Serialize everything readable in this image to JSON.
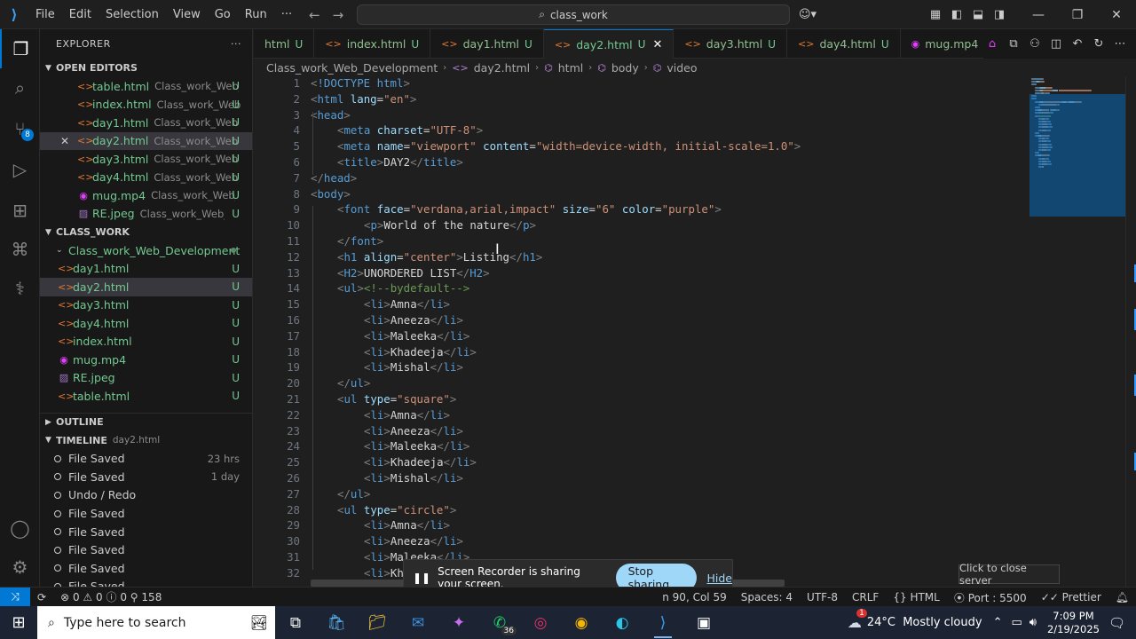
{
  "menu": [
    "File",
    "Edit",
    "Selection",
    "View",
    "Go",
    "Run"
  ],
  "menu_more": "···",
  "search": {
    "text": "class_work"
  },
  "explorer": {
    "title": "EXPLORER",
    "more": "···",
    "open_editors_title": "OPEN EDITORS",
    "open_editors": [
      {
        "name": "table.html",
        "path": "Class_work_Web_...",
        "status": "U",
        "type": "html"
      },
      {
        "name": "index.html",
        "path": "Class_work_Web...",
        "status": "U",
        "type": "html"
      },
      {
        "name": "day1.html",
        "path": "Class_work_Web_...",
        "status": "U",
        "type": "html"
      },
      {
        "name": "day2.html",
        "path": "Class_work_Web_...",
        "status": "U",
        "type": "html"
      },
      {
        "name": "day3.html",
        "path": "Class_work_Web_...",
        "status": "U",
        "type": "html"
      },
      {
        "name": "day4.html",
        "path": "Class_work_Web_...",
        "status": "U",
        "type": "html"
      },
      {
        "name": "mug.mp4",
        "path": "Class_work_Web_...",
        "status": "U",
        "type": "mp4"
      },
      {
        "name": "RE.jpeg",
        "path": "Class_work_Web_De...",
        "status": "U",
        "type": "jpeg"
      }
    ],
    "folder_title": "CLASS_WORK",
    "folder_name": "Class_work_Web_Development",
    "files": [
      {
        "name": "day1.html",
        "status": "U",
        "type": "html"
      },
      {
        "name": "day2.html",
        "status": "U",
        "type": "html"
      },
      {
        "name": "day3.html",
        "status": "U",
        "type": "html"
      },
      {
        "name": "day4.html",
        "status": "U",
        "type": "html"
      },
      {
        "name": "index.html",
        "status": "U",
        "type": "html"
      },
      {
        "name": "mug.mp4",
        "status": "U",
        "type": "mp4"
      },
      {
        "name": "RE.jpeg",
        "status": "U",
        "type": "jpeg"
      },
      {
        "name": "table.html",
        "status": "U",
        "type": "html"
      }
    ],
    "outline_title": "OUTLINE",
    "timeline_title": "TIMELINE",
    "timeline_file": "day2.html",
    "timeline": [
      {
        "label": "File Saved",
        "time": "23 hrs"
      },
      {
        "label": "File Saved",
        "time": "1 day"
      },
      {
        "label": "Undo / Redo",
        "time": ""
      },
      {
        "label": "File Saved",
        "time": ""
      },
      {
        "label": "File Saved",
        "time": ""
      },
      {
        "label": "File Saved",
        "time": ""
      },
      {
        "label": "File Saved",
        "time": ""
      },
      {
        "label": "File Saved",
        "time": ""
      }
    ]
  },
  "tabs": [
    {
      "name": "html",
      "status": "U",
      "active": false,
      "type": "html"
    },
    {
      "name": "index.html",
      "status": "U",
      "active": false,
      "type": "html"
    },
    {
      "name": "day1.html",
      "status": "U",
      "active": false,
      "type": "html"
    },
    {
      "name": "day2.html",
      "status": "U",
      "active": true,
      "type": "html"
    },
    {
      "name": "day3.html",
      "status": "U",
      "active": false,
      "type": "html"
    },
    {
      "name": "day4.html",
      "status": "U",
      "active": false,
      "type": "html"
    },
    {
      "name": "mug.mp4",
      "status": "U",
      "active": false,
      "type": "mp4"
    }
  ],
  "breadcrumb": [
    "Class_work_Web_Development",
    "day2.html",
    "html",
    "body",
    "video"
  ],
  "code_lines": [
    {
      "n": 1,
      "i": 0,
      "tokens": [
        [
          "tb",
          "<"
        ],
        [
          "t",
          "!DOCTYPE html"
        ],
        [
          "tb",
          ">"
        ]
      ]
    },
    {
      "n": 2,
      "i": 0,
      "tokens": [
        [
          "tb",
          "<"
        ],
        [
          "t",
          "html"
        ],
        [
          "tx",
          " "
        ],
        [
          "at",
          "lang"
        ],
        [
          "tx",
          "="
        ],
        [
          "av",
          "\"en\""
        ],
        [
          "tb",
          ">"
        ]
      ]
    },
    {
      "n": 3,
      "i": 0,
      "tokens": [
        [
          "tb",
          "<"
        ],
        [
          "t",
          "head"
        ],
        [
          "tb",
          ">"
        ]
      ]
    },
    {
      "n": 4,
      "i": 1,
      "tokens": [
        [
          "tb",
          "<"
        ],
        [
          "t",
          "meta"
        ],
        [
          "tx",
          " "
        ],
        [
          "at",
          "charset"
        ],
        [
          "tx",
          "="
        ],
        [
          "av",
          "\"UTF-8\""
        ],
        [
          "tb",
          ">"
        ]
      ]
    },
    {
      "n": 5,
      "i": 1,
      "tokens": [
        [
          "tb",
          "<"
        ],
        [
          "t",
          "meta"
        ],
        [
          "tx",
          " "
        ],
        [
          "at",
          "name"
        ],
        [
          "tx",
          "="
        ],
        [
          "av",
          "\"viewport\""
        ],
        [
          "tx",
          " "
        ],
        [
          "at",
          "content"
        ],
        [
          "tx",
          "="
        ],
        [
          "av",
          "\"width=device-width, initial-scale=1.0\""
        ],
        [
          "tb",
          ">"
        ]
      ]
    },
    {
      "n": 6,
      "i": 1,
      "tokens": [
        [
          "tb",
          "<"
        ],
        [
          "t",
          "title"
        ],
        [
          "tb",
          ">"
        ],
        [
          "tx",
          "DAY2"
        ],
        [
          "tb",
          "</"
        ],
        [
          "t",
          "title"
        ],
        [
          "tb",
          ">"
        ]
      ]
    },
    {
      "n": 7,
      "i": 0,
      "tokens": [
        [
          "tb",
          "</"
        ],
        [
          "t",
          "head"
        ],
        [
          "tb",
          ">"
        ]
      ]
    },
    {
      "n": 8,
      "i": 0,
      "tokens": [
        [
          "tb",
          "<"
        ],
        [
          "t",
          "body"
        ],
        [
          "tb",
          ">"
        ]
      ]
    },
    {
      "n": 9,
      "i": 1,
      "tokens": [
        [
          "tb",
          "<"
        ],
        [
          "t",
          "font"
        ],
        [
          "tx",
          " "
        ],
        [
          "at",
          "face"
        ],
        [
          "tx",
          "="
        ],
        [
          "av",
          "\"verdana,arial,impact\""
        ],
        [
          "tx",
          " "
        ],
        [
          "at",
          "size"
        ],
        [
          "tx",
          "="
        ],
        [
          "av",
          "\"6\""
        ],
        [
          "tx",
          " "
        ],
        [
          "at",
          "color"
        ],
        [
          "tx",
          "="
        ],
        [
          "av",
          "\"purple\""
        ],
        [
          "tb",
          ">"
        ]
      ]
    },
    {
      "n": 10,
      "i": 2,
      "tokens": [
        [
          "tb",
          "<"
        ],
        [
          "t",
          "p"
        ],
        [
          "tb",
          ">"
        ],
        [
          "tx",
          "World of the nature"
        ],
        [
          "tb",
          "</"
        ],
        [
          "t",
          "p"
        ],
        [
          "tb",
          ">"
        ]
      ]
    },
    {
      "n": 11,
      "i": 1,
      "tokens": [
        [
          "tb",
          "</"
        ],
        [
          "t",
          "font"
        ],
        [
          "tb",
          ">"
        ]
      ]
    },
    {
      "n": 12,
      "i": 1,
      "tokens": [
        [
          "tb",
          "<"
        ],
        [
          "t",
          "h1"
        ],
        [
          "tx",
          " "
        ],
        [
          "at",
          "align"
        ],
        [
          "tx",
          "="
        ],
        [
          "av",
          "\"center\""
        ],
        [
          "tb",
          ">"
        ],
        [
          "tx",
          "Listing"
        ],
        [
          "tb",
          "</"
        ],
        [
          "t",
          "h1"
        ],
        [
          "tb",
          ">"
        ]
      ]
    },
    {
      "n": 13,
      "i": 1,
      "tokens": [
        [
          "tb",
          "<"
        ],
        [
          "t",
          "H2"
        ],
        [
          "tb",
          ">"
        ],
        [
          "tx",
          "UNORDERED LIST"
        ],
        [
          "tb",
          "</"
        ],
        [
          "t",
          "H2"
        ],
        [
          "tb",
          ">"
        ]
      ]
    },
    {
      "n": 14,
      "i": 1,
      "tokens": [
        [
          "tb",
          "<"
        ],
        [
          "t",
          "ul"
        ],
        [
          "tb",
          ">"
        ],
        [
          "cm",
          "<!--bydefault-->"
        ]
      ]
    },
    {
      "n": 15,
      "i": 2,
      "tokens": [
        [
          "tb",
          "<"
        ],
        [
          "t",
          "li"
        ],
        [
          "tb",
          ">"
        ],
        [
          "tx",
          "Amna"
        ],
        [
          "tb",
          "</"
        ],
        [
          "t",
          "li"
        ],
        [
          "tb",
          ">"
        ]
      ]
    },
    {
      "n": 16,
      "i": 2,
      "tokens": [
        [
          "tb",
          "<"
        ],
        [
          "t",
          "li"
        ],
        [
          "tb",
          ">"
        ],
        [
          "tx",
          "Aneeza"
        ],
        [
          "tb",
          "</"
        ],
        [
          "t",
          "li"
        ],
        [
          "tb",
          ">"
        ]
      ]
    },
    {
      "n": 17,
      "i": 2,
      "tokens": [
        [
          "tb",
          "<"
        ],
        [
          "t",
          "li"
        ],
        [
          "tb",
          ">"
        ],
        [
          "tx",
          "Maleeka"
        ],
        [
          "tb",
          "</"
        ],
        [
          "t",
          "li"
        ],
        [
          "tb",
          ">"
        ]
      ]
    },
    {
      "n": 18,
      "i": 2,
      "tokens": [
        [
          "tb",
          "<"
        ],
        [
          "t",
          "li"
        ],
        [
          "tb",
          ">"
        ],
        [
          "tx",
          "Khadeeja"
        ],
        [
          "tb",
          "</"
        ],
        [
          "t",
          "li"
        ],
        [
          "tb",
          ">"
        ]
      ]
    },
    {
      "n": 19,
      "i": 2,
      "tokens": [
        [
          "tb",
          "<"
        ],
        [
          "t",
          "li"
        ],
        [
          "tb",
          ">"
        ],
        [
          "tx",
          "Mishal"
        ],
        [
          "tb",
          "</"
        ],
        [
          "t",
          "li"
        ],
        [
          "tb",
          ">"
        ]
      ]
    },
    {
      "n": 20,
      "i": 1,
      "tokens": [
        [
          "tb",
          "</"
        ],
        [
          "t",
          "ul"
        ],
        [
          "tb",
          ">"
        ]
      ]
    },
    {
      "n": 21,
      "i": 1,
      "tokens": [
        [
          "tb",
          "<"
        ],
        [
          "t",
          "ul"
        ],
        [
          "tx",
          " "
        ],
        [
          "at",
          "type"
        ],
        [
          "tx",
          "="
        ],
        [
          "av",
          "\"square\""
        ],
        [
          "tb",
          ">"
        ]
      ]
    },
    {
      "n": 22,
      "i": 2,
      "tokens": [
        [
          "tb",
          "<"
        ],
        [
          "t",
          "li"
        ],
        [
          "tb",
          ">"
        ],
        [
          "tx",
          "Amna"
        ],
        [
          "tb",
          "</"
        ],
        [
          "t",
          "li"
        ],
        [
          "tb",
          ">"
        ]
      ]
    },
    {
      "n": 23,
      "i": 2,
      "tokens": [
        [
          "tb",
          "<"
        ],
        [
          "t",
          "li"
        ],
        [
          "tb",
          ">"
        ],
        [
          "tx",
          "Aneeza"
        ],
        [
          "tb",
          "</"
        ],
        [
          "t",
          "li"
        ],
        [
          "tb",
          ">"
        ]
      ]
    },
    {
      "n": 24,
      "i": 2,
      "tokens": [
        [
          "tb",
          "<"
        ],
        [
          "t",
          "li"
        ],
        [
          "tb",
          ">"
        ],
        [
          "tx",
          "Maleeka"
        ],
        [
          "tb",
          "</"
        ],
        [
          "t",
          "li"
        ],
        [
          "tb",
          ">"
        ]
      ]
    },
    {
      "n": 25,
      "i": 2,
      "tokens": [
        [
          "tb",
          "<"
        ],
        [
          "t",
          "li"
        ],
        [
          "tb",
          ">"
        ],
        [
          "tx",
          "Khadeeja"
        ],
        [
          "tb",
          "</"
        ],
        [
          "t",
          "li"
        ],
        [
          "tb",
          ">"
        ]
      ]
    },
    {
      "n": 26,
      "i": 2,
      "tokens": [
        [
          "tb",
          "<"
        ],
        [
          "t",
          "li"
        ],
        [
          "tb",
          ">"
        ],
        [
          "tx",
          "Mishal"
        ],
        [
          "tb",
          "</"
        ],
        [
          "t",
          "li"
        ],
        [
          "tb",
          ">"
        ]
      ]
    },
    {
      "n": 27,
      "i": 1,
      "tokens": [
        [
          "tb",
          "</"
        ],
        [
          "t",
          "ul"
        ],
        [
          "tb",
          ">"
        ]
      ]
    },
    {
      "n": 28,
      "i": 1,
      "tokens": [
        [
          "tb",
          "<"
        ],
        [
          "t",
          "ul"
        ],
        [
          "tx",
          " "
        ],
        [
          "at",
          "type"
        ],
        [
          "tx",
          "="
        ],
        [
          "av",
          "\"circle\""
        ],
        [
          "tb",
          ">"
        ]
      ]
    },
    {
      "n": 29,
      "i": 2,
      "tokens": [
        [
          "tb",
          "<"
        ],
        [
          "t",
          "li"
        ],
        [
          "tb",
          ">"
        ],
        [
          "tx",
          "Amna"
        ],
        [
          "tb",
          "</"
        ],
        [
          "t",
          "li"
        ],
        [
          "tb",
          ">"
        ]
      ]
    },
    {
      "n": 30,
      "i": 2,
      "tokens": [
        [
          "tb",
          "<"
        ],
        [
          "t",
          "li"
        ],
        [
          "tb",
          ">"
        ],
        [
          "tx",
          "Aneeza"
        ],
        [
          "tb",
          "</"
        ],
        [
          "t",
          "li"
        ],
        [
          "tb",
          ">"
        ]
      ]
    },
    {
      "n": 31,
      "i": 2,
      "tokens": [
        [
          "tb",
          "<"
        ],
        [
          "t",
          "li"
        ],
        [
          "tb",
          ">"
        ],
        [
          "tx",
          "Maleeka"
        ],
        [
          "tb",
          "</"
        ],
        [
          "t",
          "li"
        ],
        [
          "tb",
          ">"
        ]
      ]
    },
    {
      "n": 32,
      "i": 2,
      "tokens": [
        [
          "tb",
          "<"
        ],
        [
          "t",
          "li"
        ],
        [
          "tb",
          ">"
        ],
        [
          "tx",
          "Kha"
        ]
      ]
    }
  ],
  "share": {
    "text": "Screen Recorder is sharing your screen.",
    "stop": "Stop sharing",
    "hide": "Hide"
  },
  "tooltip": "Click to close server",
  "status": {
    "errors": "0",
    "warnings": "0",
    "info": "0",
    "ports": "158",
    "position": "n 90, Col 59",
    "spaces": "Spaces: 4",
    "encoding": "UTF-8",
    "eol": "CRLF",
    "language": "HTML",
    "port": "Port : 5500",
    "prettier": "Prettier"
  },
  "taskbar": {
    "search_placeholder": "Type here to search",
    "whatsapp_badge": "36",
    "weather_badge": "1",
    "weather": "24°C  Mostly cloudy",
    "time": "7:09 PM",
    "date": "2/19/2025"
  },
  "colors": {
    "accent": "#0078d4",
    "untracked": "#73c991"
  }
}
